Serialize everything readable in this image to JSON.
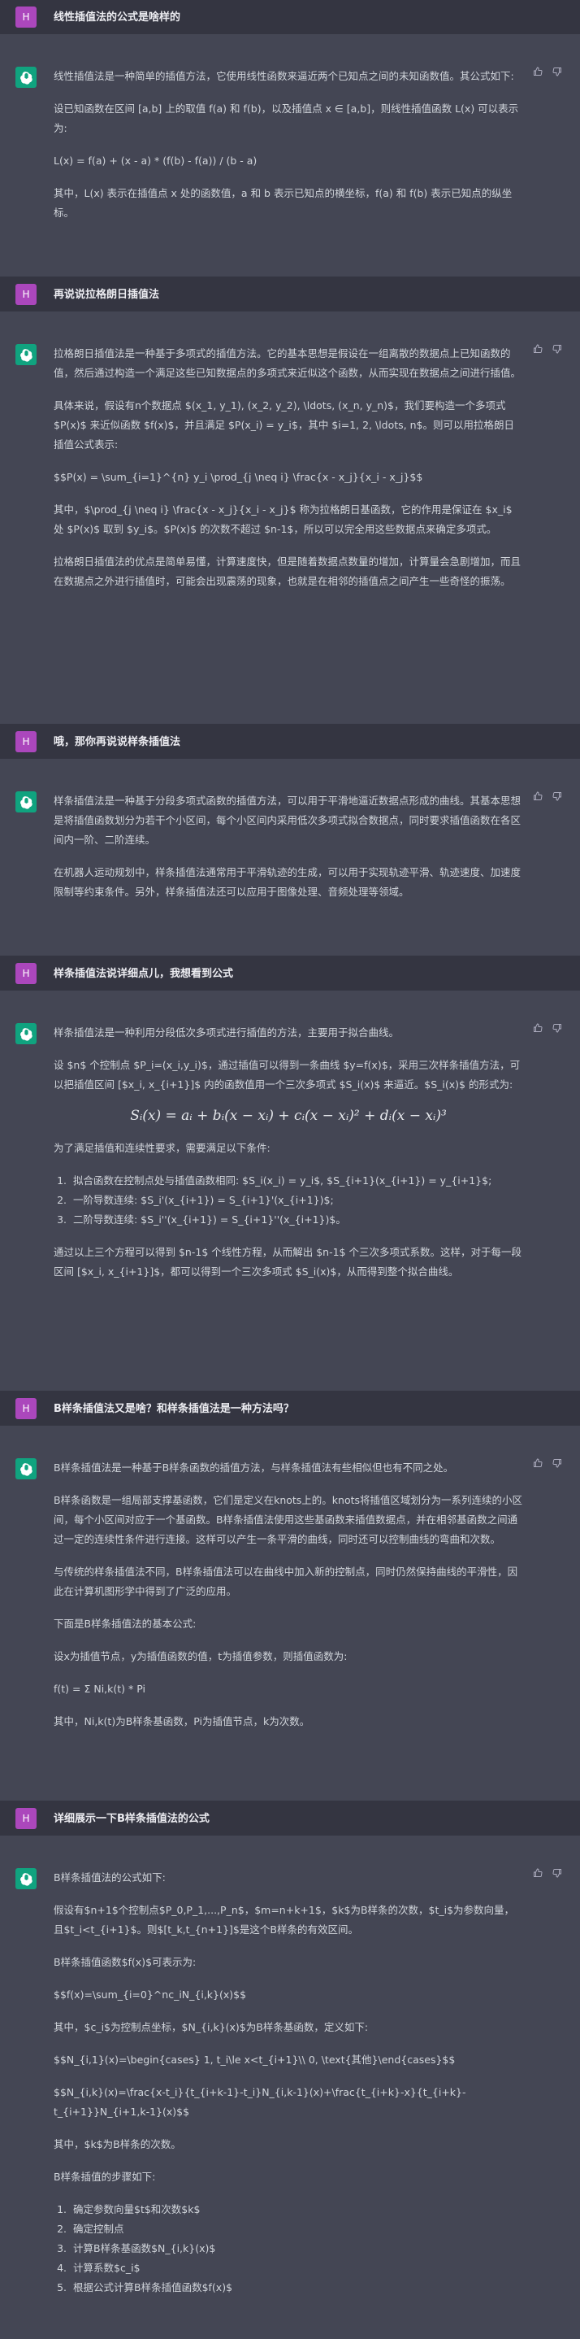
{
  "turns": [
    {
      "q": "线性插值法的公式是啥样的"
    },
    {
      "p": [
        "线性插值法是一种简单的插值方法，它使用线性函数来逼近两个已知点之间的未知函数值。其公式如下:",
        "设已知函数在区间 [a,b] 上的取值 f(a) 和 f(b)，以及插值点 x ∈ [a,b]，则线性插值函数 L(x) 可以表示为:",
        "L(x) = f(a) + (x - a) * (f(b) - f(a)) / (b - a)",
        "其中，L(x) 表示在插值点 x 处的函数值，a 和 b 表示已知点的横坐标，f(a) 和 f(b) 表示已知点的纵坐标。"
      ]
    },
    {
      "q": "再说说拉格朗日插值法"
    },
    {
      "p": [
        "拉格朗日插值法是一种基于多项式的插值方法。它的基本思想是假设在一组离散的数据点上已知函数的值，然后通过构造一个满足这些已知数据点的多项式来近似这个函数，从而实现在数据点之间进行插值。",
        "具体来说，假设有n个数据点 $(x_1, y_1), (x_2, y_2), \\ldots, (x_n, y_n)$，我们要构造一个多项式 $P(x)$ 来近似函数 $f(x)$，并且满足 $P(x_i) = y_i$，其中 $i=1, 2, \\ldots, n$。则可以用拉格朗日插值公式表示:",
        "$$P(x) = \\sum_{i=1}^{n} y_i \\prod_{j \\neq i} \\frac{x - x_j}{x_i - x_j}$$",
        "其中，$\\prod_{j \\neq i} \\frac{x - x_j}{x_i - x_j}$ 称为拉格朗日基函数，它的作用是保证在 $x_i$ 处 $P(x)$ 取到 $y_i$。$P(x)$ 的次数不超过 $n-1$，所以可以完全用这些数据点来确定多项式。",
        "拉格朗日插值法的优点是简单易懂，计算速度快，但是随着数据点数量的增加，计算量会急剧增加，而且在数据点之外进行插值时，可能会出现震荡的现象，也就是在相邻的插值点之间产生一些奇怪的振荡。"
      ]
    },
    {
      "q": "哦，那你再说说样条插值法"
    },
    {
      "p": [
        "样条插值法是一种基于分段多项式函数的插值方法，可以用于平滑地逼近数据点形成的曲线。其基本思想是将插值函数划分为若干个小区间，每个小区间内采用低次多项式拟合数据点，同时要求插值函数在各区间内一阶、二阶连续。",
        "在机器人运动规划中，样条插值法通常用于平滑轨迹的生成，可以用于实现轨迹平滑、轨迹速度、加速度限制等约束条件。另外，样条插值法还可以应用于图像处理、音频处理等领域。"
      ]
    },
    {
      "q": "样条插值法说详细点儿，我想看到公式"
    },
    {
      "p": [
        "样条插值法是一种利用分段低次多项式进行插值的方法，主要用于拟合曲线。",
        "设 $n$ 个控制点 $P_i=(x_i,y_i)$，通过插值可以得到一条曲线 $y=f(x)$，采用三次样条插值方法，可以把插值区间 [$x_i, x_{i+1}]$ 内的函数值用一个三次多项式 $S_i(x)$ 来逼近。$S_i(x)$ 的形式为:"
      ],
      "math": "Sᵢ(x) = aᵢ + bᵢ(x − xᵢ) + cᵢ(x − xᵢ)² + dᵢ(x − xᵢ)³",
      "p2": [
        "为了满足插值和连续性要求，需要满足以下条件:"
      ],
      "list": [
        "拟合函数在控制点处与插值函数相同: $S_i(x_i) = y_i$, $S_{i+1}(x_{i+1}) = y_{i+1}$;",
        "一阶导数连续: $S_i'(x_{i+1}) = S_{i+1}'(x_{i+1})$;",
        "二阶导数连续: $S_i''(x_{i+1}) = S_{i+1}''(x_{i+1})$。"
      ],
      "p3": [
        "通过以上三个方程可以得到 $n-1$ 个线性方程，从而解出 $n-1$ 个三次多项式系数。这样，对于每一段区间 [$x_i, x_{i+1}]$，都可以得到一个三次多项式 $S_i(x)$，从而得到整个拟合曲线。"
      ]
    },
    {
      "q": "B样条插值法又是啥？和样条插值法是一种方法吗？"
    },
    {
      "p": [
        "B样条插值法是一种基于B样条函数的插值方法，与样条插值法有些相似但也有不同之处。",
        "B样条函数是一组局部支撑基函数，它们是定义在knots上的。knots将插值区域划分为一系列连续的小区间，每个小区间对应于一个基函数。B样条插值法使用这些基函数来插值数据点，并在相邻基函数之间通过一定的连续性条件进行连接。这样可以产生一条平滑的曲线，同时还可以控制曲线的弯曲和次数。",
        "与传统的样条插值法不同，B样条插值法可以在曲线中加入新的控制点，同时仍然保持曲线的平滑性，因此在计算机图形学中得到了广泛的应用。",
        "下面是B样条插值法的基本公式:",
        "设x为插值节点，y为插值函数的值，t为插值参数，则插值函数为:",
        "f(t) = Σ Ni,k(t) * Pi",
        "其中，Ni,k(t)为B样条基函数，Pi为插值节点，k为次数。"
      ]
    },
    {
      "q": "详细展示一下B样条插值法的公式"
    },
    {
      "p": [
        "B样条插值法的公式如下:",
        "假设有$n+1$个控制点$P_0,P_1,...,P_n$，$m=n+k+1$，$k$为B样条的次数，$t_i$为参数向量，且$t_i<t_{i+1}$。则$[t_k,t_{n+1}]$是这个B样条的有效区间。",
        "B样条插值函数$f(x)$可表示为:",
        "$$f(x)=\\sum_{i=0}^nc_iN_{i,k}(x)$$",
        "其中，$c_i$为控制点坐标，$N_{i,k}(x)$为B样条基函数，定义如下:",
        "$$N_{i,1}(x)=\\begin{cases} 1, t_i\\le x<t_{i+1}\\\\ 0, \\text{其他}\\end{cases}$$",
        "$$N_{i,k}(x)=\\frac{x-t_i}{t_{i+k-1}-t_i}N_{i,k-1}(x)+\\frac{t_{i+k}-x}{t_{i+k}-t_{i+1}}N_{i+1,k-1}(x)$$",
        "其中，$k$为B样条的次数。",
        "B样条插值的步骤如下:"
      ],
      "list": [
        "确定参数向量$t$和次数$k$",
        "确定控制点",
        "计算B样条基函数$N_{i,k}(x)$",
        "计算系数$c_i$",
        "根据公式计算B样条插值函数$f(x)$"
      ]
    }
  ],
  "user_avatar": "H",
  "colors": {
    "user_bg": "#343541",
    "bot_bg": "#444654",
    "user_avatar": "#ab47bc",
    "bot_avatar": "#10a37f"
  }
}
